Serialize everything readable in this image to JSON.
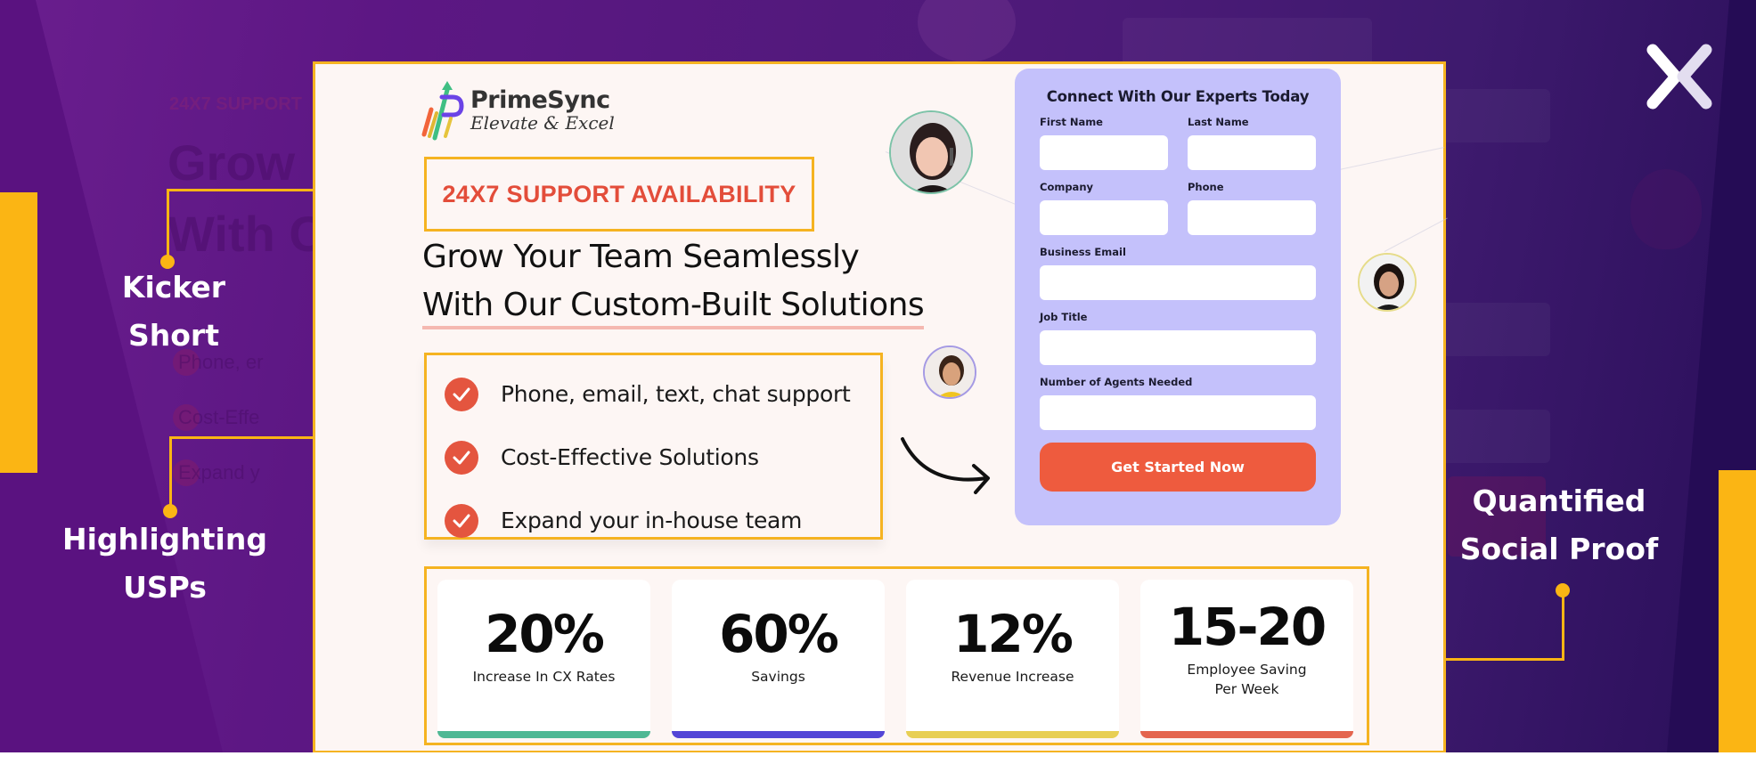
{
  "annotations": {
    "kicker": [
      "Kicker",
      "Short"
    ],
    "usps": [
      "Highlighting",
      "USPs"
    ],
    "social_proof": [
      "Quantified",
      "Social Proof"
    ],
    "accent_color": "#fbb514"
  },
  "brand_logo_icon": "x-logo-icon",
  "landing_page": {
    "logo": {
      "name": "PrimeSync",
      "tagline": "Elevate & Excel"
    },
    "kicker": "24X7 SUPPORT AVAILABILITY",
    "headline": {
      "line1": "Grow Your Team Seamlessly",
      "line2": "With Our Custom-Built Solutions"
    },
    "usps": [
      {
        "icon": "check-circle-icon",
        "text": "Phone, email, text, chat support"
      },
      {
        "icon": "check-circle-icon",
        "text": "Cost-Effective Solutions"
      },
      {
        "icon": "check-circle-icon",
        "text": "Expand your in-house team"
      }
    ],
    "form": {
      "title": "Connect With Our Experts Today",
      "fields": {
        "first_name": {
          "label": "First Name",
          "value": ""
        },
        "last_name": {
          "label": "Last Name",
          "value": ""
        },
        "company": {
          "label": "Company",
          "value": ""
        },
        "phone": {
          "label": "Phone",
          "value": ""
        },
        "business_email": {
          "label": "Business Email",
          "value": ""
        },
        "job_title": {
          "label": "Job Title",
          "value": ""
        },
        "agents_needed": {
          "label": "Number of Agents Needed",
          "value": ""
        }
      },
      "submit_label": "Get Started Now",
      "submit_color": "#ee5b3e",
      "background_color": "#c4c1fb"
    },
    "stats": [
      {
        "value": "20%",
        "label": "Increase In CX Rates",
        "color": "#4fb894"
      },
      {
        "value": "60%",
        "label": "Savings",
        "color": "#5345d6"
      },
      {
        "value": "12%",
        "label": "Revenue Increase",
        "color": "#e8cf54"
      },
      {
        "value": "15-20",
        "label": "Employee Saving Per Week",
        "color": "#e4654e"
      }
    ],
    "kicker_color": "#e34d3a",
    "check_color": "#e4553f"
  },
  "background_ghost": {
    "kicker": "24X7 SUPPORT",
    "headline_1": "Grow",
    "headline_2": "With C",
    "item_1": "Phone, er",
    "item_2": "Cost-Effe",
    "item_3": "Expand y"
  }
}
